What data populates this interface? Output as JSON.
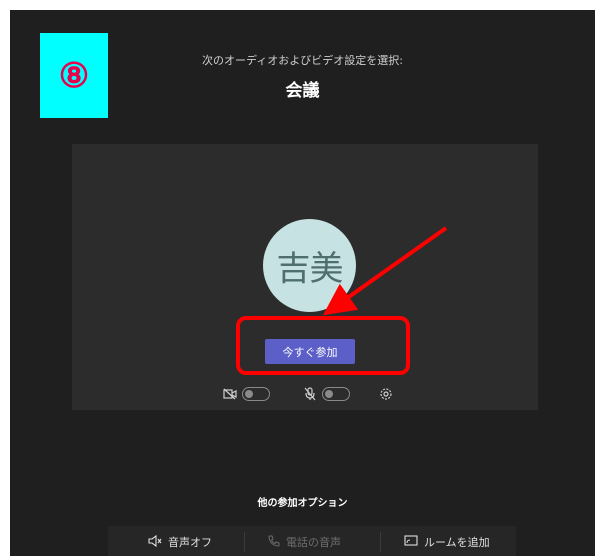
{
  "step_badge": "⑧",
  "header": {
    "subtitle": "次のオーディオおよびビデオ設定を選択:",
    "title": "会議"
  },
  "preview": {
    "avatar_initials": "吉美",
    "join_button": "今すぐ参加",
    "camera_on": false,
    "mic_on": false
  },
  "other_options": {
    "heading": "他の参加オプション",
    "audio_off": "音声オフ",
    "phone_audio": "電話の音声",
    "add_room": "ルームを追加"
  },
  "colors": {
    "accent": "#5b5fc7",
    "annotation": "#ff0000",
    "badge_bg": "#00ffff"
  }
}
